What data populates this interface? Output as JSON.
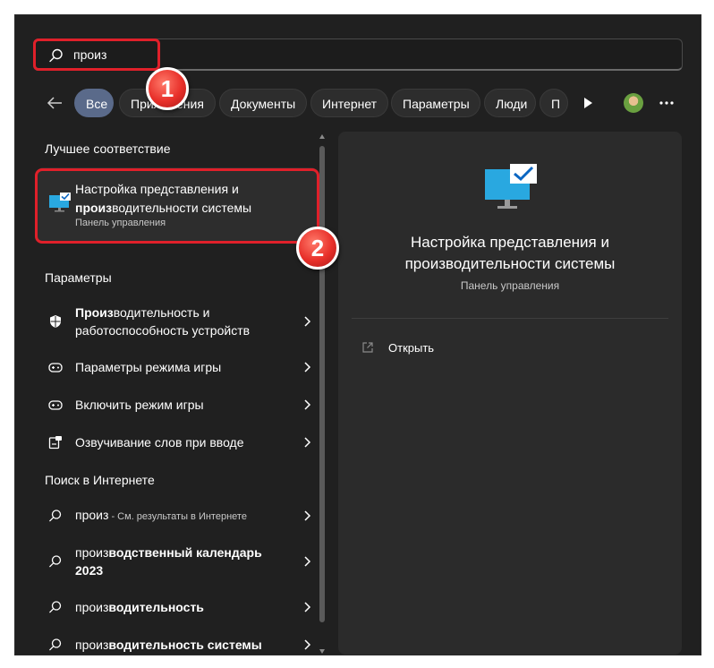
{
  "search": {
    "value": "произ"
  },
  "tabs": [
    {
      "label": "Все",
      "active": true
    },
    {
      "label": "Приложения"
    },
    {
      "label": "Документы"
    },
    {
      "label": "Интернет"
    },
    {
      "label": "Параметры"
    },
    {
      "label": "Люди"
    },
    {
      "label": "П"
    }
  ],
  "sections": {
    "best_match": "Лучшее соответствие",
    "settings": "Параметры",
    "web": "Поиск в Интернете"
  },
  "best_match": {
    "title_line1": "Настройка представления и",
    "title_bold": "произ",
    "title_rest": "водительности системы",
    "subtitle": "Панель управления"
  },
  "settings_items": [
    {
      "bold": "Произ",
      "rest": "водительность и",
      "line2": "работоспособность устройств",
      "icon": "shield-icon"
    },
    {
      "label": "Параметры режима игры",
      "icon": "gamepad-icon"
    },
    {
      "label": "Включить режим игры",
      "icon": "gamepad-icon"
    },
    {
      "label": "Озвучивание слов при вводе",
      "icon": "narrator-icon"
    }
  ],
  "web_items": [
    {
      "label": "произ",
      "suffix": " - См. результаты в Интернете"
    },
    {
      "prefix": "произ",
      "bold": "водственный календарь",
      "line2": "2023"
    },
    {
      "prefix": "произ",
      "bold": "водительность"
    },
    {
      "prefix": "произ",
      "bold": "водительность системы"
    }
  ],
  "preview": {
    "title_line1": "Настройка представления и",
    "title_line2": "производительности системы",
    "subtitle": "Панель управления",
    "open_label": "Открыть"
  },
  "badges": {
    "one": "1",
    "two": "2"
  },
  "colors": {
    "highlight": "#e0202a",
    "accent": "#0078d4",
    "background": "#202020"
  }
}
